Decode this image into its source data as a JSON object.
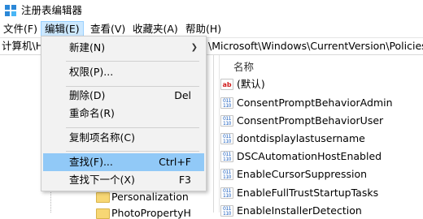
{
  "window": {
    "title": "注册表编辑器"
  },
  "menubar": {
    "items": [
      {
        "label": "文件(F)"
      },
      {
        "label": "编辑(E)"
      },
      {
        "label": "查看(V)"
      },
      {
        "label": "收藏夹(A)"
      },
      {
        "label": "帮助(H)"
      }
    ]
  },
  "address": {
    "left": "计算机\\H",
    "right": "\\Microsoft\\Windows\\CurrentVersion\\Policies\\"
  },
  "tree": {
    "items": [
      {
        "label": "Personalization"
      },
      {
        "label": "PhotoPropertyH"
      }
    ]
  },
  "list": {
    "column_name": "名称",
    "values": [
      {
        "name": "(默认)",
        "icon": "string-value-icon"
      },
      {
        "name": "ConsentPromptBehaviorAdmin",
        "icon": "dword-value-icon"
      },
      {
        "name": "ConsentPromptBehaviorUser",
        "icon": "dword-value-icon"
      },
      {
        "name": "dontdisplaylastusername",
        "icon": "dword-value-icon"
      },
      {
        "name": "DSCAutomationHostEnabled",
        "icon": "dword-value-icon"
      },
      {
        "name": "EnableCursorSuppression",
        "icon": "dword-value-icon"
      },
      {
        "name": "EnableFullTrustStartupTasks",
        "icon": "dword-value-icon"
      },
      {
        "name": "EnableInstallerDetection",
        "icon": "dword-value-icon"
      }
    ]
  },
  "edit_menu": {
    "new": {
      "label": "新建(N)"
    },
    "permissions": {
      "label": "权限(P)..."
    },
    "delete": {
      "label": "删除(D)",
      "shortcut": "Del"
    },
    "rename": {
      "label": "重命名(R)"
    },
    "copy_key_name": {
      "label": "复制项名称(C)"
    },
    "find": {
      "label": "查找(F)...",
      "shortcut": "Ctrl+F"
    },
    "find_next": {
      "label": "查找下一个(X)",
      "shortcut": "F3"
    }
  },
  "icons": {
    "string_value": {
      "glyph": "ab"
    },
    "dword_value": {
      "glyph": "011\n110"
    }
  },
  "colors": {
    "menu_active_bg": "#cce8ff",
    "dropdown_highlight": "#91c9f7",
    "folder": "#f7d774"
  }
}
